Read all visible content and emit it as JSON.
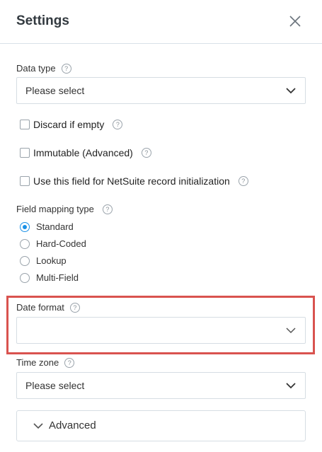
{
  "header": {
    "title": "Settings"
  },
  "data_type": {
    "label": "Data type",
    "value": "Please select"
  },
  "checkboxes": [
    {
      "label": "Discard if empty",
      "checked": false
    },
    {
      "label": "Immutable (Advanced)",
      "checked": false
    },
    {
      "label": "Use this field for NetSuite record initialization",
      "checked": false
    }
  ],
  "field_mapping": {
    "label": "Field mapping type",
    "options": [
      {
        "label": "Standard",
        "selected": true
      },
      {
        "label": "Hard-Coded",
        "selected": false
      },
      {
        "label": "Lookup",
        "selected": false
      },
      {
        "label": "Multi-Field",
        "selected": false
      }
    ]
  },
  "date_format": {
    "label": "Date format",
    "value": ""
  },
  "time_zone": {
    "label": "Time zone",
    "value": "Please select"
  },
  "advanced": {
    "label": "Advanced"
  },
  "help_glyph": "?",
  "colors": {
    "accent": "#1a90e6",
    "highlight": "#d9534f",
    "border": "#d6dde3"
  }
}
